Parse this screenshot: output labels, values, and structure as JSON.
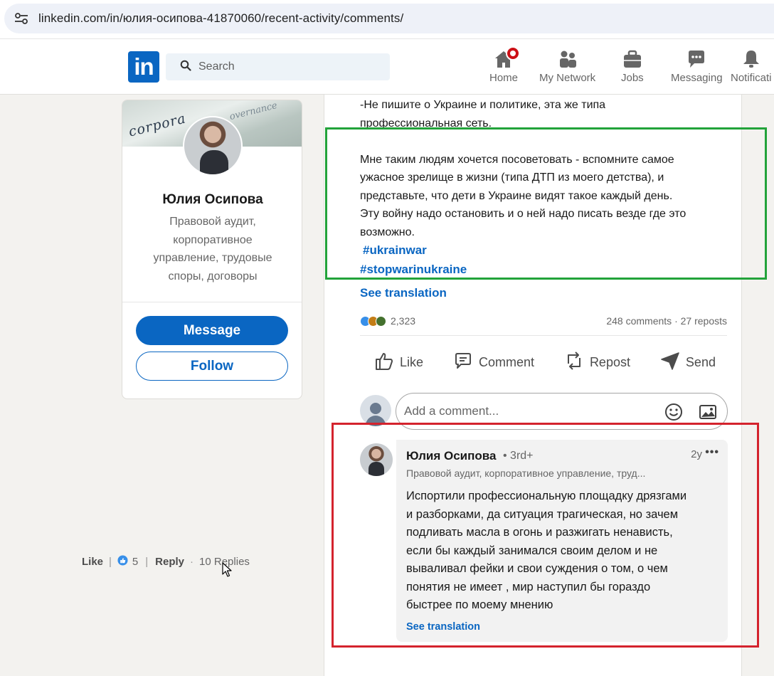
{
  "browser": {
    "url": "linkedin.com/in/юлия-осипова-41870060/recent-activity/comments/",
    "site_settings_icon": "tune-icon"
  },
  "header": {
    "logo": "in",
    "search_placeholder": "Search",
    "nav": [
      {
        "label": "Home",
        "icon": "home-icon"
      },
      {
        "label": "My Network",
        "icon": "network-icon"
      },
      {
        "label": "Jobs",
        "icon": "briefcase-icon"
      },
      {
        "label": "Messaging",
        "icon": "chat-icon"
      },
      {
        "label": "Notificati",
        "icon": "bell-icon"
      }
    ]
  },
  "profile": {
    "name": "Юлия Осипова",
    "headline": "Правовой аудит, корпоративное управление, трудовые споры, договоры",
    "message_label": "Message",
    "follow_label": "Follow"
  },
  "post": {
    "lines_top": [
      "-Не пишите о Украине и политике, эта же типа",
      "профессиональная сеть."
    ],
    "paragraph": [
      "Мне таким людям хочется посоветовать - вспомните самое",
      "ужасное зрелище в жизни (типа ДТП из моего детства), и",
      "представьте, что дети в Украине видят такое каждый день.",
      "Эту войну надо остановить и о ней надо писать везде где это",
      "возможно."
    ],
    "hashtags": [
      "#ukrainwar",
      "#stopwarinukraine"
    ],
    "see_translation": "See translation",
    "reactions_count": "2,323",
    "comments_reposts": "248 comments · 27 reposts",
    "actions": [
      "Like",
      "Comment",
      "Repost",
      "Send"
    ],
    "comment_placeholder": "Add a comment..."
  },
  "comment": {
    "author": "Юлия Осипова",
    "degree": "• 3rd+",
    "time": "2y",
    "more": "•••",
    "headline": "Правовой аудит, корпоративное управление, труд...",
    "text_lines": [
      "Испортили профессиональную площадку дрязгами",
      "и разборками, да ситуация трагическая, но зачем",
      "подливать масла в огонь и разжигать ненависть,",
      "если бы каждый занимался своим делом и не",
      "вываливал фейки и свои суждения о том, о чем",
      "понятия не имеет , мир наступил бы гораздо",
      "быстрее по моему мнению"
    ],
    "see_translation": "See translation",
    "like_label": "Like",
    "like_count": "5",
    "reply_label": "Reply",
    "replies": "10 Replies"
  },
  "colors": {
    "brand": "#0a66c2",
    "highlight_green": "#22a33a",
    "highlight_red": "#d4232d"
  }
}
